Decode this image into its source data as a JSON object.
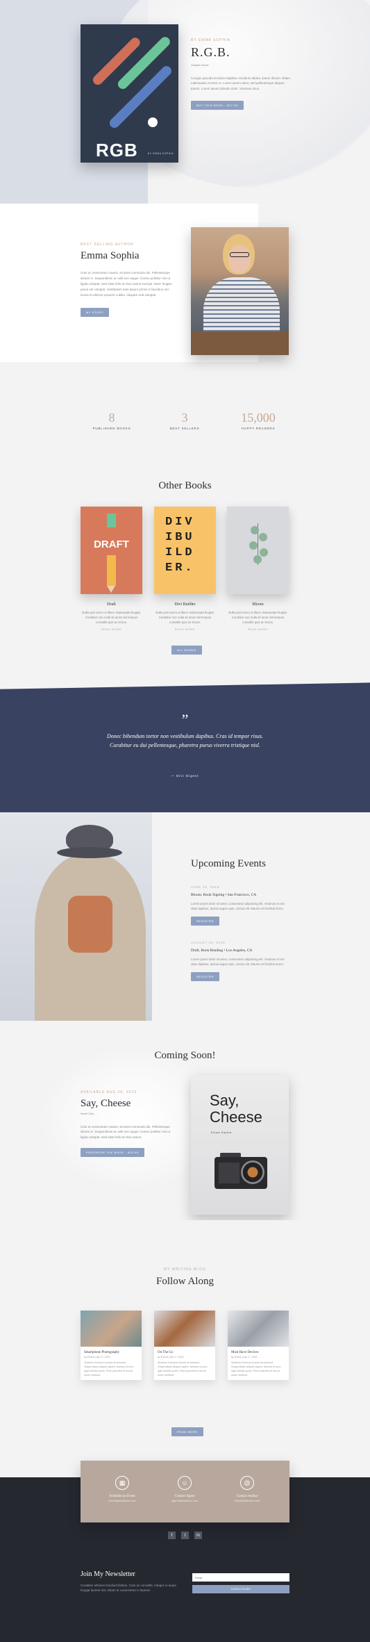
{
  "hero": {
    "eyebrow": "by Emma Sophia",
    "title": "R.G.B.",
    "subtitle": "Graphic Novel",
    "description": "Congue gravida tincidunt dapibus. Dividium labitur, ipsum dictum. Etiam malesuada ut tortor in. Lorem ipsum dolor, sed pellentesque aliquet. Ipsum. Lorem ipsum lobortis dolor. Vivamus risus.",
    "button": "Buy this book - $17.99",
    "cover_title": "RGB",
    "cover_author": "by Emma Sophia"
  },
  "author": {
    "eyebrow": "Best Selling Author",
    "name": "Emma Sophia",
    "bio": "Cras ut consectetur mauris, sit amet commodo dui. Pellentesque dictum in. Suspendisse ac velit nec augue. Donec porttitor nisi ut ligula volutpat. Sed vitae felis at risus varius suscipit. Nunc feugiat purus vel volutpat. Vestibulum ante ipsum primis in faucibus orci luctus et ultrices posuere cubilia. Aliquam erat volutpat.",
    "button": "My Story"
  },
  "stats": [
    {
      "value": "8",
      "label": "Published Books"
    },
    {
      "value": "3",
      "label": "Best Sellers"
    },
    {
      "value": "15,000",
      "label": "Happy Readers"
    }
  ],
  "other_books": {
    "title": "Other Books",
    "books": [
      {
        "title": "Draft",
        "desc": "Nulla quis lorem ut libero malesuada feugiat. Curabitur non nulla sit amet nisl tempus convallis quis ac lectus.",
        "more": "Read More"
      },
      {
        "title": "Divi Builder",
        "desc": "Nulla quis lorem ut libero malesuada feugiat. Curabitur non nulla sit amet nisl tempus convallis quis ac lectus.",
        "more": "Read More"
      },
      {
        "title": "Bloom",
        "desc": "Nulla quis lorem ut libero malesuada feugiat. Curabitur non nulla sit amet nisl tempus convallis quis ac lectus.",
        "more": "Read More"
      }
    ],
    "button": "All Books",
    "cover_draft": "DRAFT",
    "cover_divi": "DIV IBU ILD ER."
  },
  "quote": {
    "mark": "”",
    "text": "Donec bibendum tortor non vestibulum dapibus. Cras id tempor risus. Curabitur eu dui pellentesque, pharetra purus viverra tristique nisl.",
    "source": "— Divi Digest"
  },
  "events": {
    "title": "Upcoming Events",
    "items": [
      {
        "date": "June 29, 2019",
        "title": "Bloom, Book Signing • San Francisco, CA",
        "desc": "Lorem ipsum dolor sit amet, consectetur adipiscing elit. Vivamus et nisi vitae dapibus, lacinia augue quis, cursus elit. Mauris vel facilisis lorem.",
        "button": "Register"
      },
      {
        "date": "August 18, 2019",
        "title": "Draft, Book Reading • Los Angeles, CA",
        "desc": "Lorem ipsum dolor sit amet, consectetur adipiscing elit. Vivamus et nisi vitae dapibus, lacinia augue quis, cursus elit. Mauris vel facilisis lorem.",
        "button": "Register"
      }
    ]
  },
  "coming_soon": {
    "title": "Coming Soon!",
    "eyebrow": "Available Aug 28, 2019",
    "book_title": "Say, Cheese",
    "subtitle": "Novel Club",
    "desc": "Cras ut consectetur mauris, sit amet commodo dui. Pellentesque dictum in. Suspendisse ac velit nec augue. Donec porttitor nisi ut ligula volutpat. Sed vitae felis at risus varius.",
    "button": "Preorder the book - $24.99",
    "cover_title": "Say, Cheese",
    "cover_author": "Emma Sophia"
  },
  "follow": {
    "eyebrow": "My Writing Blog",
    "title": "Follow Along",
    "posts": [
      {
        "title": "Smartphone Photography",
        "meta": "by Emma | Apr 17, 2019",
        "excerpt": "Vivamus rhoncus ut justo at euismod. Suspendisse aliquet sapien. Aenean id arcu eget lobortis porta. Proin pharetra et nisl at lorem eleifend."
      },
      {
        "title": "On The Go",
        "meta": "by Emma | Apr 17, 2019",
        "excerpt": "Vivamus rhoncus ut justo at euismod. Suspendisse aliquet sapien. Aenean id arcu eget lobortis porta. Proin pharetra et nisl at lorem eleifend."
      },
      {
        "title": "Must Have Devices",
        "meta": "by Emma | Apr 17, 2019",
        "excerpt": "Vivamus rhoncus ut justo at euismod. Suspendisse aliquet sapien. Aenean id arcu eget lobortis porta. Proin pharetra et nisl at lorem eleifend."
      }
    ],
    "button": "Read More"
  },
  "contact": [
    {
      "icon": "calendar-icon",
      "glyph": "▦",
      "title": "Schedule an Event",
      "sub": "events@diviauthor.com"
    },
    {
      "icon": "user-icon",
      "glyph": "☺",
      "title": "Contact Agent",
      "sub": "agent@diviauthor.com"
    },
    {
      "icon": "at-icon",
      "glyph": "@",
      "title": "Contact Author",
      "sub": "hello@diviauthor.com"
    }
  ],
  "social": [
    "f",
    "t",
    "in"
  ],
  "newsletter": {
    "title": "Join My Newsletter",
    "desc": "Curabitur ultricies tincidunt finibus. Cras ac convallis. Integer a neque feugiat laoreet nisi. Etiam et consectetur in laoreet.",
    "placeholder": "Email",
    "button": "Subscribe"
  },
  "colors": {
    "accent": "#8ea0c1",
    "tan": "#c7a994",
    "navy": "#394260",
    "footer": "#262830"
  }
}
